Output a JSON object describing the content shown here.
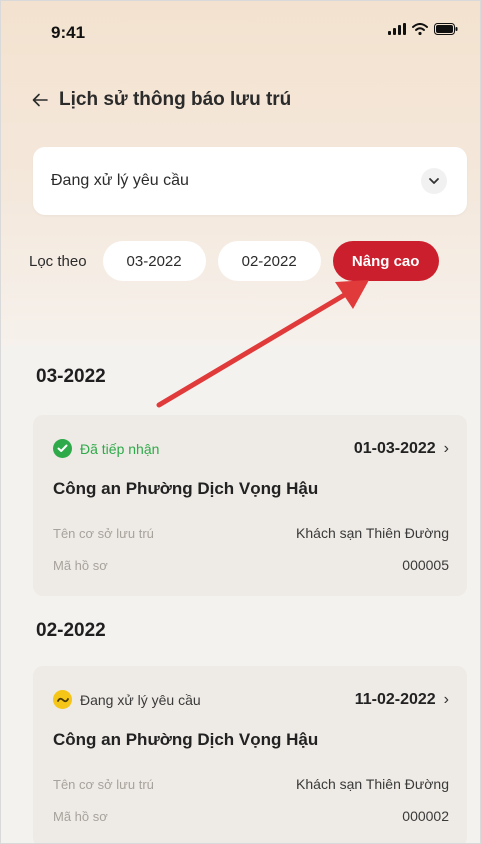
{
  "status_bar": {
    "time": "9:41"
  },
  "header": {
    "title": "Lịch sử thông báo lưu trú"
  },
  "dropdown": {
    "value": "Đang xử lý yêu cầu"
  },
  "filter": {
    "label": "Lọc theo",
    "chips": [
      "03-2022",
      "02-2022"
    ],
    "advanced": "Nâng cao"
  },
  "colors": {
    "accent": "#cc1f2d",
    "received": "#2eaa4a",
    "processing": "#f5c518",
    "arrow": "#e03a3a"
  },
  "groups": [
    {
      "label": "03-2022",
      "card": {
        "status": "Đã tiếp nhận",
        "status_icon": "check-circle-icon",
        "date": "01-03-2022",
        "office": "Công an Phường Dịch Vọng Hậu",
        "facility_label": "Tên cơ sở lưu trú",
        "facility_value": "Khách sạn Thiên Đường",
        "record_label": "Mã hồ sơ",
        "record_value": "000005"
      }
    },
    {
      "label": "02-2022",
      "card": {
        "status": "Đang xử lý yêu cầu",
        "status_icon": "processing-icon",
        "date": "11-02-2022",
        "office": "Công an Phường Dịch Vọng Hậu",
        "facility_label": "Tên cơ sở lưu trú",
        "facility_value": "Khách sạn Thiên Đường",
        "record_label": "Mã hồ sơ",
        "record_value": "000002"
      }
    }
  ]
}
